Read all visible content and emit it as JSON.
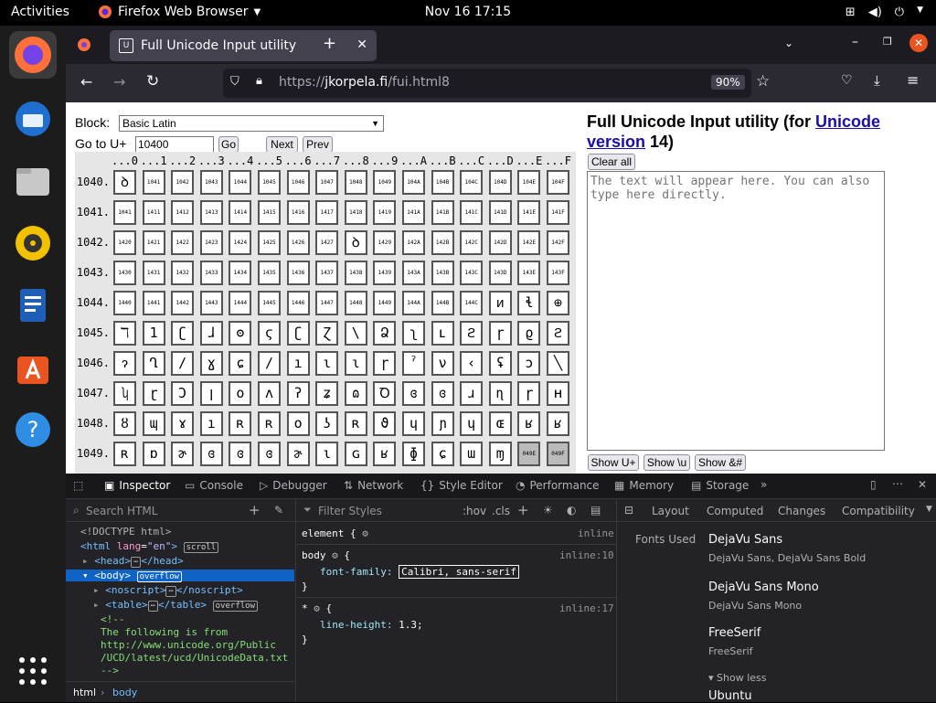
{
  "topbar": {
    "activities": "Activities",
    "app": "Firefox Web Browser",
    "clock": "Nov 16  17:15"
  },
  "tab": {
    "title": "Full Unicode Input utility"
  },
  "url": {
    "prefix": "https://",
    "domain": "jkorpela.fi",
    "path": "/fui.html8",
    "zoom": "90%"
  },
  "page": {
    "block_label": "Block:",
    "block_value": "Basic Latin",
    "goto_label": "Go to U+",
    "goto_value": "10400",
    "go": "Go",
    "next": "Next",
    "prev": "Prev",
    "title_pre": "Full Unicode Input utility (for ",
    "title_link1": "Unicode",
    "title_link2": "version",
    "title_post": " 14)",
    "clear_all": "Clear all",
    "placeholder": "The text will appear here. You can also type here directly.",
    "show_u": "Show U+",
    "show_bs": "Show \\u",
    "show_amp": "Show &#",
    "col_headers": [
      "...0",
      "...1",
      "...2",
      "...3",
      "...4",
      "...5",
      "...6",
      "...7",
      "...8",
      "...9",
      "...A",
      "...B",
      "...C",
      "...D",
      "...E",
      "...F"
    ],
    "rows": [
      {
        "label": "1040.",
        "cells": [
          "ꝺ",
          "1041",
          "1042",
          "1043",
          "1044",
          "1045",
          "1046",
          "1047",
          "1048",
          "1049",
          "104A",
          "104B",
          "104C",
          "104D",
          "104E",
          "104F"
        ]
      },
      {
        "label": "1041.",
        "cells": [
          "1041",
          "1411",
          "1412",
          "1413",
          "1414",
          "1415",
          "1416",
          "1417",
          "1418",
          "1419",
          "141A",
          "141B",
          "141C",
          "141D",
          "141E",
          "141F"
        ]
      },
      {
        "label": "1042.",
        "cells": [
          "1420",
          "1421",
          "1422",
          "1423",
          "1424",
          "1425",
          "1426",
          "1427",
          "ꝺ",
          "1429",
          "142A",
          "142B",
          "142C",
          "142D",
          "142E",
          "142F"
        ]
      },
      {
        "label": "1043.",
        "cells": [
          "1430",
          "1431",
          "1432",
          "1433",
          "1434",
          "1435",
          "1436",
          "1437",
          "1438",
          "1439",
          "143A",
          "143B",
          "143C",
          "143D",
          "143E",
          "143F"
        ]
      },
      {
        "label": "1044.",
        "cells": [
          "1440",
          "1441",
          "1442",
          "1443",
          "1444",
          "1445",
          "1446",
          "1447",
          "1448",
          "1449",
          "144A",
          "144B",
          "144C",
          "ᴎ",
          "ɬ",
          "⊕"
        ]
      },
      {
        "label": "1045.",
        "cells": [
          "ℸ",
          "1",
          "ʗ",
          "ɺ",
          "ʘ",
          "ϛ",
          "ʗ",
          "Ɀ",
          "\\",
          "Ձ",
          "ʅ",
          "ʟ",
          "ϩ",
          "ɼ",
          "ϱ",
          "ϩ"
        ]
      },
      {
        "label": "1046.",
        "cells": [
          "ɂ",
          "Ղ",
          "∕",
          "ɣ",
          "ɕ",
          "∕",
          "ı",
          "ɩ",
          "ɩ",
          "ɼ",
          "ˀ",
          "ν",
          "‹",
          "ʢ",
          "ɔ",
          "╲"
        ]
      },
      {
        "label": "1047.",
        "cells": [
          "ʮ",
          "ɽ",
          "Ͻ",
          "ן",
          "o",
          "ʌ",
          "ʔ",
          "ʑ",
          "ɷ",
          "Ꝺ",
          "ɞ",
          "ɞ",
          "ɹ",
          "ɳ",
          "ɼ",
          "ʜ"
        ]
      },
      {
        "label": "1048.",
        "cells": [
          "ȣ",
          "ɰ",
          "ɤ",
          "ı",
          "ʀ",
          "ʀ",
          "o",
          "ʖ",
          "ʀ",
          "ϑ",
          "ɥ",
          "ɲ",
          "ɥ",
          "ɶ",
          "ʁ",
          "ʁ"
        ]
      },
      {
        "label": "1049.",
        "cells": [
          "ʀ",
          "ɒ",
          "ɚ",
          "ɞ",
          "ɞ",
          "ɞ",
          "ɚ",
          "ɩ",
          "ɢ",
          "ʁ",
          "ɸ",
          "ɕ",
          "ɯ",
          "ɱ",
          "049E",
          "049F"
        ]
      }
    ]
  },
  "devtools": {
    "tabs": [
      "Inspector",
      "Console",
      "Debugger",
      "Network",
      "Style Editor",
      "Performance",
      "Memory",
      "Storage"
    ],
    "search_placeholder": "Search HTML",
    "filter_placeholder": "Filter Styles",
    "hov": ":hov",
    "cls": ".cls",
    "tree": {
      "doctype": "<!DOCTYPE html>",
      "html_open": "<html",
      "lang_attr": "lang",
      "lang_val": "\"en\"",
      "html_close": ">",
      "scroll": "scroll",
      "head": "<head>",
      "head_end": "</head>",
      "body": "<body>",
      "overflow": "overflow",
      "noscript": "<noscript>",
      "noscript_end": "</noscript>",
      "table": "<table>",
      "table_end": "</table>",
      "comment1": "<!--",
      "comment2": "The following is from",
      "comment3": "http://www.unicode.org/Public",
      "comment4": "/UCD/latest/ucd/UnicodeData.txt",
      "comment5": "-->"
    },
    "rules": {
      "element": "element {",
      "inline": "inline",
      "body_sel": "body",
      "body_src": "inline:10",
      "prop1": "font-family:",
      "val1": "Calibri, sans-serif",
      "star_sel": "*",
      "star_src": "inline:17",
      "prop2": "line-height:",
      "val2": "1.3;"
    },
    "right_tabs": [
      "Layout",
      "Computed",
      "Changes",
      "Compatibility"
    ],
    "fonts_used": "Fonts Used",
    "fonts": [
      {
        "name": "DejaVu Sans",
        "sub": "DejaVu Sans, DejaVu Sans Bold"
      },
      {
        "name": "DejaVu Sans Mono",
        "sub": "DejaVu Sans Mono"
      },
      {
        "name": "FreeSerif",
        "sub": "FreeSerif"
      }
    ],
    "show_less": "▾ Show less",
    "ubuntu": "Ubuntu",
    "breadcrumb": [
      "html",
      "body"
    ]
  },
  "colors": {
    "accent": "#0e63c4",
    "firefox": "#ff7139"
  }
}
